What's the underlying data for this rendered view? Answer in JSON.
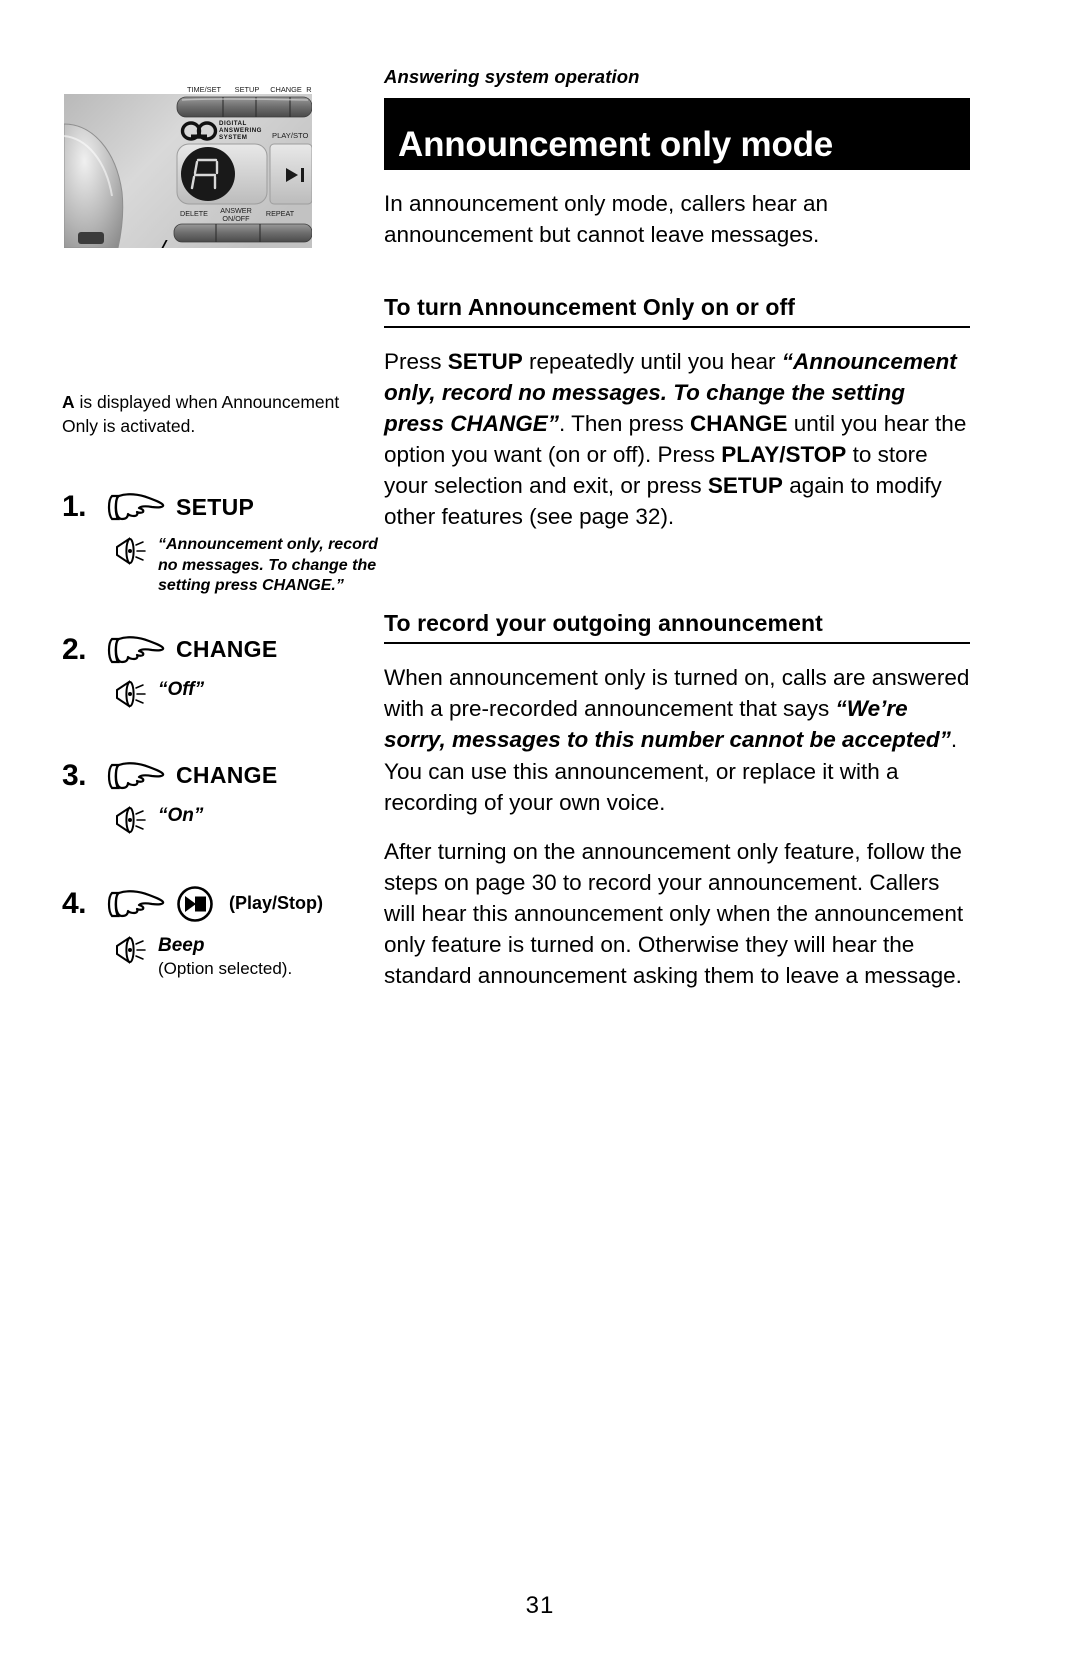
{
  "document": {
    "running_head": "Answering system operation",
    "page_number": "31"
  },
  "title_bar": {
    "title": "Announcement only mode"
  },
  "intro": {
    "text": "In announcement only mode, callers hear an announcement but cannot leave messages."
  },
  "sections": [
    {
      "heading": "To turn Announcement Only on or off",
      "paragraphs": [
        {
          "runs": [
            {
              "text": "Press ",
              "style": "normal"
            },
            {
              "text": "SETUP",
              "style": "bold"
            },
            {
              "text": " repeatedly until you hear ",
              "style": "normal"
            },
            {
              "text": "“Announcement only, record no messages. To change the setting press CHANGE”",
              "style": "bolditalic"
            },
            {
              "text": ". Then press ",
              "style": "normal"
            },
            {
              "text": "CHANGE",
              "style": "bold"
            },
            {
              "text": " until you hear the option you want (on or off). Press ",
              "style": "normal"
            },
            {
              "text": "PLAY/STOP",
              "style": "bold"
            },
            {
              "text": " to store your selection and exit, or press ",
              "style": "normal"
            },
            {
              "text": "SETUP",
              "style": "bold"
            },
            {
              "text": " again to modify other features (see page 32).",
              "style": "normal"
            }
          ]
        }
      ]
    },
    {
      "heading": "To record your outgoing announcement",
      "paragraphs": [
        {
          "runs": [
            {
              "text": "When announcement only is turned on, calls are answered with a pre-recorded announcement that says ",
              "style": "normal"
            },
            {
              "text": "“We’re sorry, messages to this number cannot be accepted”",
              "style": "bolditalic"
            },
            {
              "text": ". You can use this announcement, or replace it with a recording of your own voice.",
              "style": "normal"
            }
          ]
        },
        {
          "runs": [
            {
              "text": "After turning on the announcement only feature, follow the steps on page 30 to record your announcement. Callers will hear this announcement only when the announcement only feature is turned on. Otherwise they will hear the standard announcement asking them to leave a message.",
              "style": "normal"
            }
          ]
        }
      ]
    }
  ],
  "figure": {
    "caption_bold": "A",
    "caption_rest": " is displayed when Announcement Only is activated.",
    "display_character": "A",
    "logo_text_line1": "DIGITAL",
    "logo_text_line2": "ANSWERING",
    "logo_text_line3": "SYSTEM",
    "top_buttons": [
      "TIME/SET",
      "SETUP",
      "CHANGE",
      "REC"
    ],
    "play_stop_label": "PLAY/STOP",
    "play_stop_glyph": "▶/■",
    "bottom_buttons": [
      "DELETE",
      "ANSWER ON/OFF",
      "REPEAT"
    ],
    "bottom_button_1": "DELETE",
    "bottom_button_2_line1": "ANSWER",
    "bottom_button_2_line2": "ON/OFF",
    "bottom_button_3": "REPEAT"
  },
  "steps": [
    {
      "number": "1.",
      "button_label": "SETUP",
      "icon": "pointing-hand",
      "response": "“Announcement only, record no messages. To change the setting press CHANGE.”",
      "response_note": null,
      "response_size": "small"
    },
    {
      "number": "2.",
      "button_label": "CHANGE",
      "icon": "pointing-hand",
      "response": "“Off”",
      "response_note": null,
      "response_size": "big"
    },
    {
      "number": "3.",
      "button_label": "CHANGE",
      "icon": "pointing-hand",
      "response": "“On”",
      "response_note": null,
      "response_size": "big"
    },
    {
      "number": "4.",
      "button_label": "(Play/Stop)",
      "icon": "pointing-hand-playstop",
      "response": "Beep",
      "response_note": "(Option selected).",
      "response_size": "big"
    }
  ],
  "colors": {
    "title_bar_bg": "#000000",
    "title_bar_text": "#ffffff",
    "body_text": "#000000",
    "page_bg": "#ffffff"
  }
}
